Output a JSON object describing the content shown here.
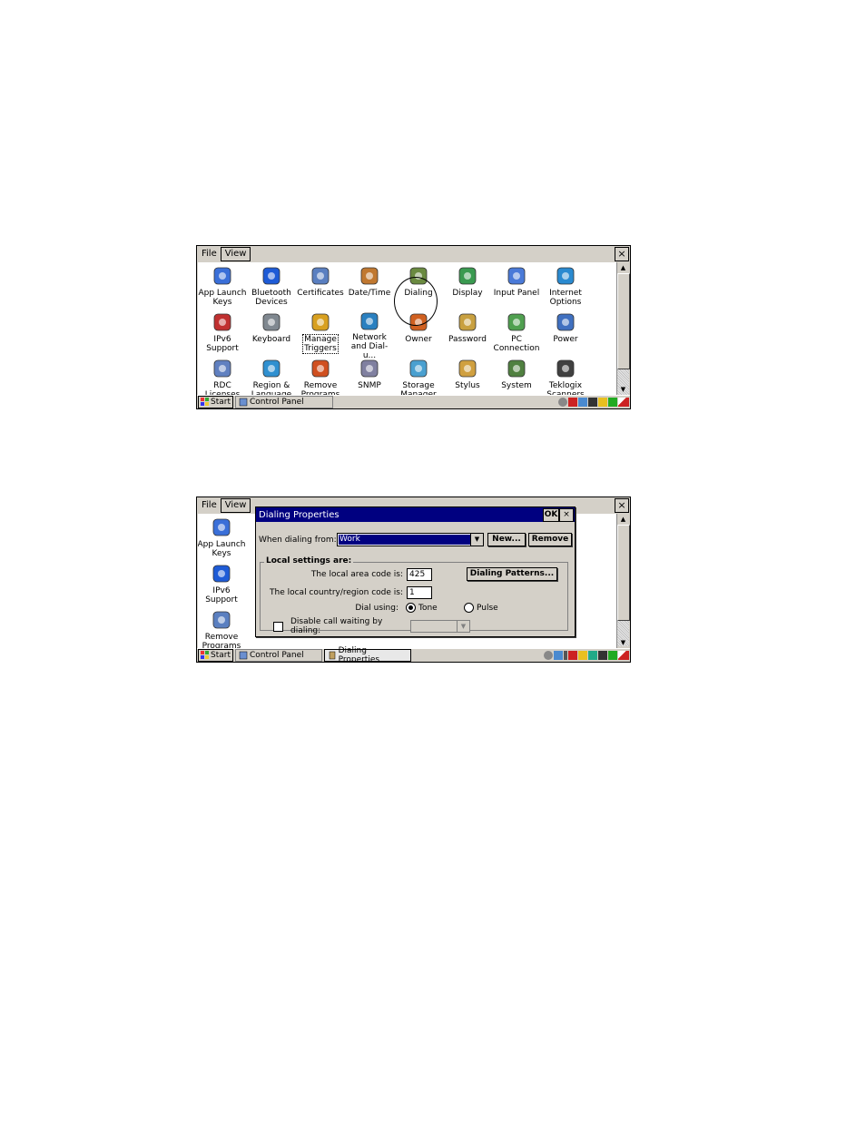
{
  "panel1": {
    "menu": [
      "File",
      "View"
    ],
    "close": "×",
    "items": [
      {
        "label": "App Launch\nKeys",
        "icon": "app-launch-keys-icon"
      },
      {
        "label": "Bluetooth\nDevices",
        "icon": "bluetooth-icon"
      },
      {
        "label": "Certificates",
        "icon": "certificates-icon"
      },
      {
        "label": "Date/Time",
        "icon": "date-time-icon"
      },
      {
        "label": "Dialing",
        "icon": "dialing-icon"
      },
      {
        "label": "Display",
        "icon": "display-icon"
      },
      {
        "label": "Input Panel",
        "icon": "input-panel-icon"
      },
      {
        "label": "Internet\nOptions",
        "icon": "internet-options-icon"
      },
      {
        "label": "IPv6\nSupport",
        "icon": "ipv6-icon"
      },
      {
        "label": "Keyboard",
        "icon": "keyboard-icon"
      },
      {
        "label": "Manage\nTriggers",
        "icon": "manage-triggers-icon"
      },
      {
        "label": "Network\nand Dial-u...",
        "icon": "network-icon"
      },
      {
        "label": "Owner",
        "icon": "owner-icon"
      },
      {
        "label": "Password",
        "icon": "password-icon"
      },
      {
        "label": "PC\nConnection",
        "icon": "pc-connection-icon"
      },
      {
        "label": "Power",
        "icon": "power-icon"
      },
      {
        "label": "RDC\nLicenses",
        "icon": "rdc-icon"
      },
      {
        "label": "Region &\nLanguage",
        "icon": "region-icon"
      },
      {
        "label": "Remove\nPrograms",
        "icon": "remove-programs-icon"
      },
      {
        "label": "SNMP",
        "icon": "snmp-icon"
      },
      {
        "label": "Storage\nManager",
        "icon": "storage-icon"
      },
      {
        "label": "Stylus",
        "icon": "stylus-icon"
      },
      {
        "label": "System",
        "icon": "system-icon"
      },
      {
        "label": "Teklogix\nScanners",
        "icon": "scanners-icon"
      }
    ],
    "taskbar": {
      "start": "Start",
      "tasks": [
        "Control Panel"
      ]
    }
  },
  "panel2": {
    "menu": [
      "File",
      "View"
    ],
    "close": "×",
    "items": [
      {
        "label": "App Launch\nKeys",
        "icon": "app-launch-keys-icon"
      },
      {
        "label": "IPv6\nSupport",
        "icon": "ipv6-icon"
      },
      {
        "label": "Remove\nPrograms",
        "icon": "remove-programs-icon"
      }
    ],
    "taskbar": {
      "start": "Start",
      "tasks": [
        "Control Panel",
        "Dialing Properties"
      ]
    },
    "dialog": {
      "title": "Dialing Properties",
      "ok": "OK",
      "close": "×",
      "when_label": "When dialing from:",
      "when_value": "Work",
      "new_btn": "New...",
      "remove_btn": "Remove",
      "group_title": "Local settings are:",
      "area_label": "The local area code is:",
      "area_value": "425",
      "country_label": "The local country/region code is:",
      "country_value": "1",
      "patterns_btn": "Dialing Patterns...",
      "dial_using_label": "Dial using:",
      "tone_label": "Tone",
      "pulse_label": "Pulse",
      "tone_selected": true,
      "disable_wait_label": "Disable call waiting by dialing:",
      "disable_wait_checked": false
    }
  },
  "colors": {
    "titlebar": "#000080",
    "face": "#d4d0c8"
  }
}
